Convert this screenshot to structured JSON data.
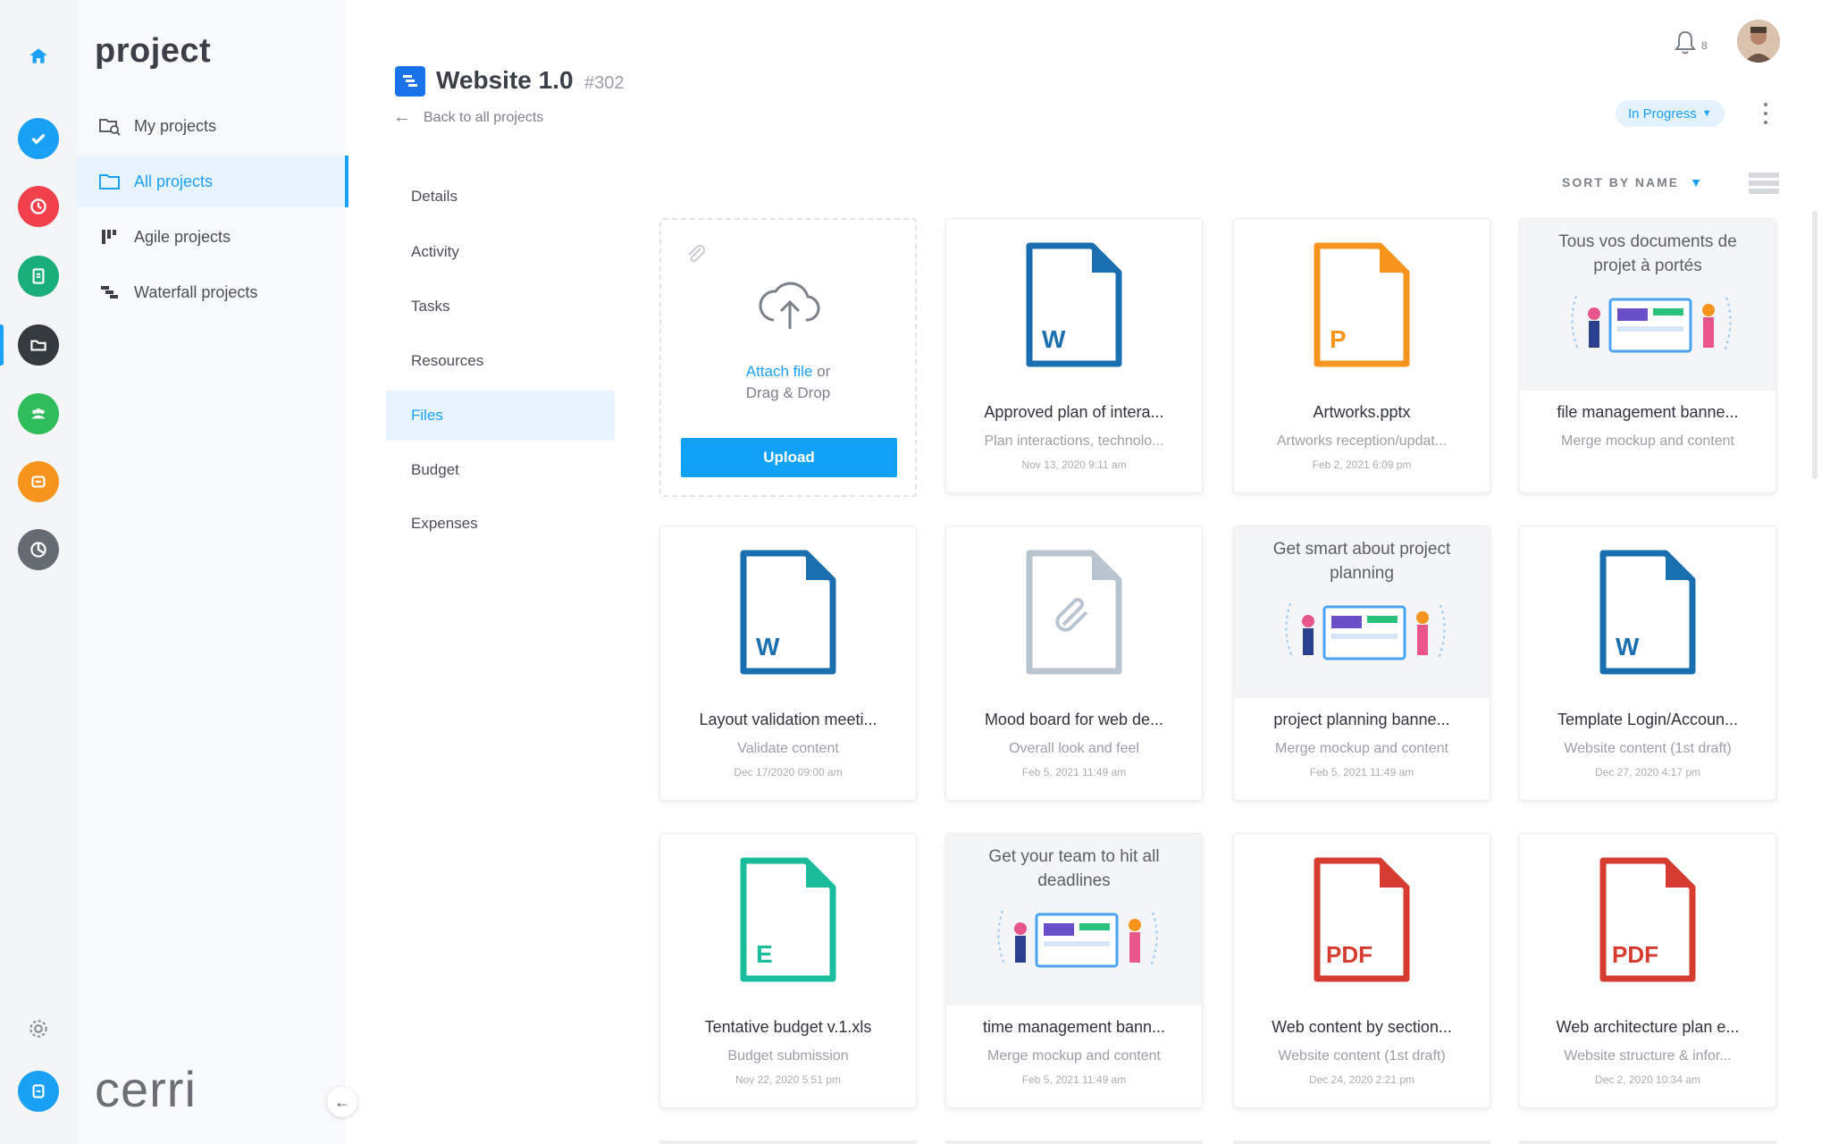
{
  "app": {
    "module_title": "project",
    "brand": "cerri"
  },
  "colors": {
    "accent": "#1aa0f5",
    "word": "#1a6fb0",
    "powerpoint": "#f7941d",
    "excel": "#1abc9c",
    "pdf": "#d63b2f",
    "generic": "#b8c4d0"
  },
  "rail": [
    {
      "name": "home-icon",
      "color": "#1aa0f5"
    },
    {
      "name": "tasks-icon",
      "color": "#1aa0f5"
    },
    {
      "name": "time-icon",
      "color": "#f0414d"
    },
    {
      "name": "reports-icon",
      "color": "#1aaf7a"
    },
    {
      "name": "projects-icon",
      "color": "#353a40"
    },
    {
      "name": "teams-icon",
      "color": "#2ebd5a"
    },
    {
      "name": "crm-icon",
      "color": "#f7941d"
    },
    {
      "name": "analytics-icon",
      "color": "#646b73"
    },
    {
      "name": "settings-icon",
      "color": "#8a9096"
    },
    {
      "name": "account-icon",
      "color": "#1aa0f5"
    }
  ],
  "sidebar": {
    "items": [
      {
        "label": "My projects",
        "icon": "search-folder-icon"
      },
      {
        "label": "All projects",
        "icon": "folder-icon"
      },
      {
        "label": "Agile projects",
        "icon": "agile-icon"
      },
      {
        "label": "Waterfall projects",
        "icon": "waterfall-icon"
      }
    ],
    "active_index": 1
  },
  "header": {
    "title": "Website 1.0",
    "id": "#302",
    "back": "Back to all projects",
    "status": "In Progress",
    "notifications": "8"
  },
  "subnav": {
    "items": [
      "Details",
      "Activity",
      "Tasks",
      "Resources",
      "Files",
      "Budget",
      "Expenses"
    ],
    "active_index": 4
  },
  "toolbar": {
    "sort_label": "SORT BY NAME"
  },
  "upload": {
    "link": "Attach file",
    "or": " or",
    "drag": "Drag & Drop",
    "button": "Upload"
  },
  "files": [
    {
      "type": "word",
      "name": "Approved plan of intera...",
      "desc": "Plan interactions, technolo...",
      "date": "Nov 13, 2020 9:11 am"
    },
    {
      "type": "powerpoint",
      "name": "Artworks.pptx",
      "desc": "Artworks reception/updat...",
      "date": "Feb 2, 2021 6:09 pm"
    },
    {
      "type": "banner",
      "banner": "Tous vos documents de projet à portés",
      "name": "file management banne...",
      "desc": "Merge mockup and content",
      "date": ""
    },
    {
      "type": "word",
      "name": "Layout validation meeti...",
      "desc": "Validate content",
      "date": "Dec 17/2020 09:00 am"
    },
    {
      "type": "generic",
      "name": "Mood board for web de...",
      "desc": "Overall look and feel",
      "date": "Feb 5, 2021 11:49 am"
    },
    {
      "type": "banner",
      "banner": "Get smart about project planning",
      "name": "project planning banne...",
      "desc": "Merge mockup and content",
      "date": "Feb 5, 2021 11:49 am"
    },
    {
      "type": "word",
      "name": "Template Login/Accoun...",
      "desc": "Website content (1st draft)",
      "date": "Dec 27, 2020 4:17 pm"
    },
    {
      "type": "excel",
      "name": "Tentative budget v.1.xls",
      "desc": "Budget submission",
      "date": "Nov 22, 2020 5:51 pm"
    },
    {
      "type": "banner",
      "banner": "Get your team to hit all deadlines",
      "name": "time management bann...",
      "desc": "Merge mockup and content",
      "date": "Feb 5, 2021 11:49 am"
    },
    {
      "type": "pdf",
      "name": "Web content by section...",
      "desc": "Website content (1st draft)",
      "date": "Dec 24, 2020 2:21 pm"
    },
    {
      "type": "pdf",
      "name": "Web architecture plan e...",
      "desc": "Website structure & infor...",
      "date": "Dec 2, 2020 10:34 am"
    }
  ],
  "doc_letters": {
    "word": "W",
    "powerpoint": "P",
    "excel": "E",
    "pdf": "PDF"
  }
}
